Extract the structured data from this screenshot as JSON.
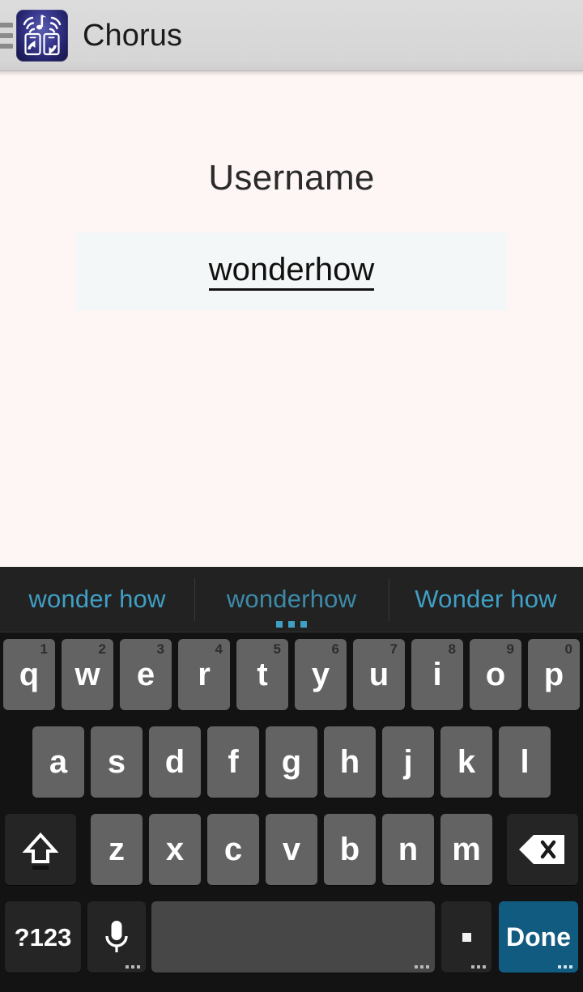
{
  "header": {
    "menu_icon": "hamburger-menu-icon",
    "app_icon": "chorus-app-icon",
    "title": "Chorus"
  },
  "form": {
    "label": "Username",
    "value": "wonderhow"
  },
  "keyboard": {
    "suggestions": [
      {
        "text": "wonder how",
        "active": false
      },
      {
        "text": "wonderhow",
        "active": true
      },
      {
        "text": "Wonder how",
        "active": false
      }
    ],
    "row1": [
      {
        "letter": "q",
        "number": "1"
      },
      {
        "letter": "w",
        "number": "2"
      },
      {
        "letter": "e",
        "number": "3"
      },
      {
        "letter": "r",
        "number": "4"
      },
      {
        "letter": "t",
        "number": "5"
      },
      {
        "letter": "y",
        "number": "6"
      },
      {
        "letter": "u",
        "number": "7"
      },
      {
        "letter": "i",
        "number": "8"
      },
      {
        "letter": "o",
        "number": "9"
      },
      {
        "letter": "p",
        "number": "0"
      }
    ],
    "row2": [
      {
        "letter": "a"
      },
      {
        "letter": "s"
      },
      {
        "letter": "d"
      },
      {
        "letter": "f"
      },
      {
        "letter": "g"
      },
      {
        "letter": "h"
      },
      {
        "letter": "j"
      },
      {
        "letter": "k"
      },
      {
        "letter": "l"
      }
    ],
    "row3": [
      {
        "letter": "z"
      },
      {
        "letter": "x"
      },
      {
        "letter": "c"
      },
      {
        "letter": "v"
      },
      {
        "letter": "b"
      },
      {
        "letter": "n"
      },
      {
        "letter": "m"
      }
    ],
    "shift_icon": "shift-arrow-icon",
    "backspace_icon": "backspace-delete-icon",
    "symbols_label": "?123",
    "mic_icon": "microphone-icon",
    "space_label": "",
    "period_label": ".",
    "enter_label": "Done"
  },
  "colors": {
    "accent": "#3f9fc4",
    "done_key": "#115b80",
    "key": "#636363",
    "key_dark": "#252525",
    "content_bg": "#fdf6f5",
    "header_bg": "#d6d6d6"
  }
}
